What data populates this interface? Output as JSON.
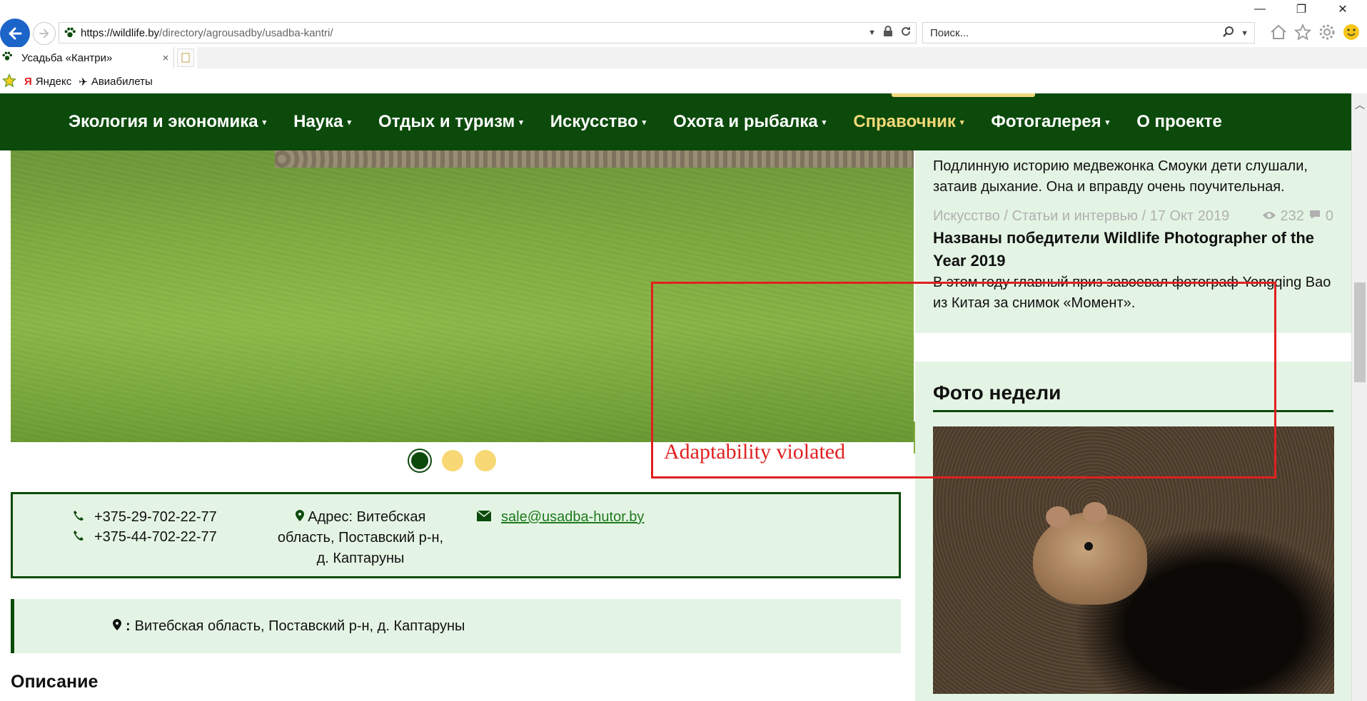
{
  "browser": {
    "url_host": "https://wildlife.by",
    "url_path": "/directory/agrousadby/usadba-kantri/",
    "search_placeholder": "Поиск...",
    "tab_title": "Усадьба «Кантри»",
    "tab_close": "×",
    "favorites": [
      {
        "label": "Яндекс"
      },
      {
        "label": "Авиабилеты"
      }
    ]
  },
  "nav": {
    "items": [
      {
        "label": "Экология и экономика",
        "has_caret": true
      },
      {
        "label": "Наука",
        "has_caret": true
      },
      {
        "label": "Отдых и туризм",
        "has_caret": true
      },
      {
        "label": "Искусство",
        "has_caret": true
      },
      {
        "label": "Охота и рыбалка",
        "has_caret": true
      },
      {
        "label": "Справочник",
        "has_caret": true,
        "active": true
      },
      {
        "label": "Фотогалерея",
        "has_caret": true
      },
      {
        "label": "О проекте",
        "has_caret": false
      }
    ],
    "caret": "▾",
    "active_color": "#f2d877",
    "bg_color": "#0c4a0c"
  },
  "contact": {
    "phones": [
      "+375-29-702-22-77",
      "+375-44-702-22-77"
    ],
    "address_lines": [
      "Адрес: Витебская",
      "область, Поставский р-н,",
      "д. Каптаруны"
    ],
    "email": "sale@usadba-hutor.by"
  },
  "address_strip": {
    "label": ":",
    "value": "Витебская область, Поставский р-н, д. Каптаруны"
  },
  "description_title": "Описание",
  "sidebar": {
    "news_excerpt_1": "Подлинную историю медвежонка Смоуки дети слушали, затаив дыхание. Она и вправду очень поучительная.",
    "news_meta": "Искусство / Статьи и интервью / 17 Окт 2019",
    "news_views": "232",
    "news_comments": "0",
    "news_title": "Названы победители Wildlife Photographer of the Year 2019",
    "news_excerpt_2": "В этом году главный приз завоевал фотограф Yongqing Bao из Китая за снимок «Момент».",
    "photo_week_title": "Фото недели"
  },
  "annotation": {
    "label": "Adaptability violated",
    "color": "#e02020"
  }
}
